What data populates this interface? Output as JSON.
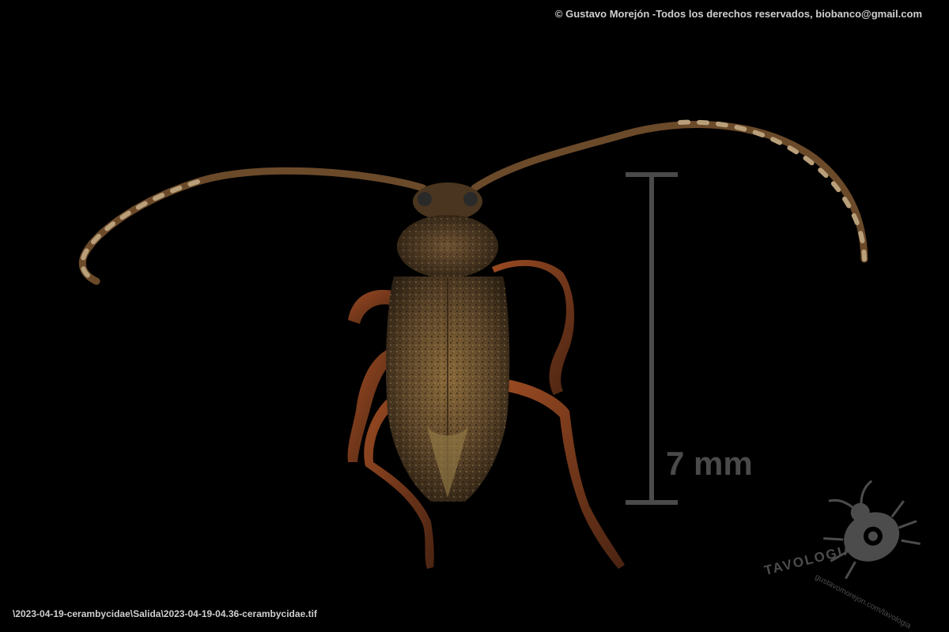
{
  "photo": {
    "copyright": "© Gustavo Morejón -Todos los derechos reservados, biobanco@gmail.com",
    "file_path": "\\2023-04-19-cerambycidae\\Salida\\2023-04-19-04.36-cerambycidae.tif",
    "background_color": "#000000"
  },
  "scale_bar": {
    "label": "7 mm",
    "color": "#4a4a4a"
  },
  "logo": {
    "brand": "TAVOLOGIA",
    "url": "gustavomorejon.com/tavologia"
  },
  "subject": {
    "icon": "longhorn-beetle-icon",
    "colors": {
      "body": "#5a4328",
      "body_highlight": "#8a6a3a",
      "legs": "#7a3a1c",
      "antenna": "#6b4a2a",
      "antenna_pale": "#b9a07a"
    }
  }
}
